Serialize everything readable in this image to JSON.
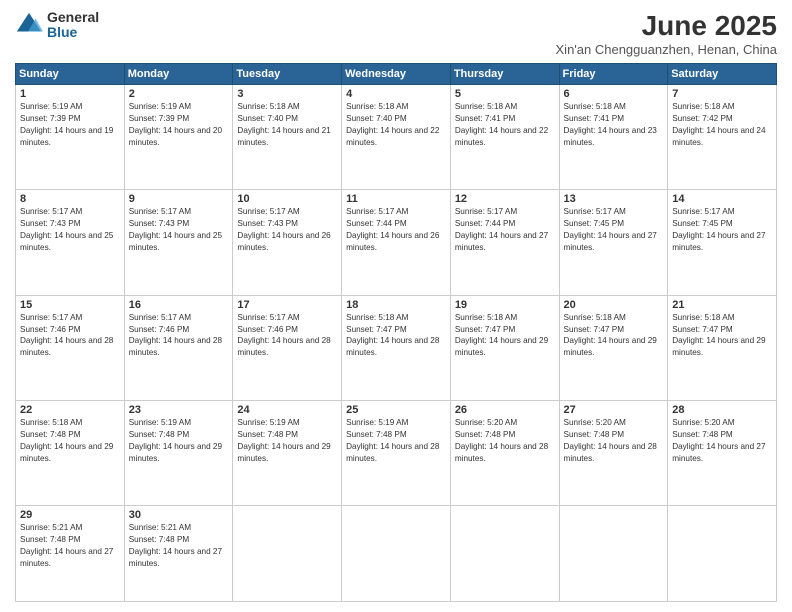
{
  "header": {
    "logo_general": "General",
    "logo_blue": "Blue",
    "month_title": "June 2025",
    "location": "Xin'an Chengguanzhen, Henan, China"
  },
  "days_of_week": [
    "Sunday",
    "Monday",
    "Tuesday",
    "Wednesday",
    "Thursday",
    "Friday",
    "Saturday"
  ],
  "weeks": [
    [
      {
        "day": "1",
        "sunrise": "5:19 AM",
        "sunset": "7:39 PM",
        "daylight": "14 hours and 19 minutes."
      },
      {
        "day": "2",
        "sunrise": "5:19 AM",
        "sunset": "7:39 PM",
        "daylight": "14 hours and 20 minutes."
      },
      {
        "day": "3",
        "sunrise": "5:18 AM",
        "sunset": "7:40 PM",
        "daylight": "14 hours and 21 minutes."
      },
      {
        "day": "4",
        "sunrise": "5:18 AM",
        "sunset": "7:40 PM",
        "daylight": "14 hours and 22 minutes."
      },
      {
        "day": "5",
        "sunrise": "5:18 AM",
        "sunset": "7:41 PM",
        "daylight": "14 hours and 22 minutes."
      },
      {
        "day": "6",
        "sunrise": "5:18 AM",
        "sunset": "7:41 PM",
        "daylight": "14 hours and 23 minutes."
      },
      {
        "day": "7",
        "sunrise": "5:18 AM",
        "sunset": "7:42 PM",
        "daylight": "14 hours and 24 minutes."
      }
    ],
    [
      {
        "day": "8",
        "sunrise": "5:17 AM",
        "sunset": "7:43 PM",
        "daylight": "14 hours and 25 minutes."
      },
      {
        "day": "9",
        "sunrise": "5:17 AM",
        "sunset": "7:43 PM",
        "daylight": "14 hours and 25 minutes."
      },
      {
        "day": "10",
        "sunrise": "5:17 AM",
        "sunset": "7:43 PM",
        "daylight": "14 hours and 26 minutes."
      },
      {
        "day": "11",
        "sunrise": "5:17 AM",
        "sunset": "7:44 PM",
        "daylight": "14 hours and 26 minutes."
      },
      {
        "day": "12",
        "sunrise": "5:17 AM",
        "sunset": "7:44 PM",
        "daylight": "14 hours and 27 minutes."
      },
      {
        "day": "13",
        "sunrise": "5:17 AM",
        "sunset": "7:45 PM",
        "daylight": "14 hours and 27 minutes."
      },
      {
        "day": "14",
        "sunrise": "5:17 AM",
        "sunset": "7:45 PM",
        "daylight": "14 hours and 27 minutes."
      }
    ],
    [
      {
        "day": "15",
        "sunrise": "5:17 AM",
        "sunset": "7:46 PM",
        "daylight": "14 hours and 28 minutes."
      },
      {
        "day": "16",
        "sunrise": "5:17 AM",
        "sunset": "7:46 PM",
        "daylight": "14 hours and 28 minutes."
      },
      {
        "day": "17",
        "sunrise": "5:17 AM",
        "sunset": "7:46 PM",
        "daylight": "14 hours and 28 minutes."
      },
      {
        "day": "18",
        "sunrise": "5:18 AM",
        "sunset": "7:47 PM",
        "daylight": "14 hours and 28 minutes."
      },
      {
        "day": "19",
        "sunrise": "5:18 AM",
        "sunset": "7:47 PM",
        "daylight": "14 hours and 29 minutes."
      },
      {
        "day": "20",
        "sunrise": "5:18 AM",
        "sunset": "7:47 PM",
        "daylight": "14 hours and 29 minutes."
      },
      {
        "day": "21",
        "sunrise": "5:18 AM",
        "sunset": "7:47 PM",
        "daylight": "14 hours and 29 minutes."
      }
    ],
    [
      {
        "day": "22",
        "sunrise": "5:18 AM",
        "sunset": "7:48 PM",
        "daylight": "14 hours and 29 minutes."
      },
      {
        "day": "23",
        "sunrise": "5:19 AM",
        "sunset": "7:48 PM",
        "daylight": "14 hours and 29 minutes."
      },
      {
        "day": "24",
        "sunrise": "5:19 AM",
        "sunset": "7:48 PM",
        "daylight": "14 hours and 29 minutes."
      },
      {
        "day": "25",
        "sunrise": "5:19 AM",
        "sunset": "7:48 PM",
        "daylight": "14 hours and 28 minutes."
      },
      {
        "day": "26",
        "sunrise": "5:20 AM",
        "sunset": "7:48 PM",
        "daylight": "14 hours and 28 minutes."
      },
      {
        "day": "27",
        "sunrise": "5:20 AM",
        "sunset": "7:48 PM",
        "daylight": "14 hours and 28 minutes."
      },
      {
        "day": "28",
        "sunrise": "5:20 AM",
        "sunset": "7:48 PM",
        "daylight": "14 hours and 27 minutes."
      }
    ],
    [
      {
        "day": "29",
        "sunrise": "5:21 AM",
        "sunset": "7:48 PM",
        "daylight": "14 hours and 27 minutes."
      },
      {
        "day": "30",
        "sunrise": "5:21 AM",
        "sunset": "7:48 PM",
        "daylight": "14 hours and 27 minutes."
      },
      null,
      null,
      null,
      null,
      null
    ]
  ]
}
